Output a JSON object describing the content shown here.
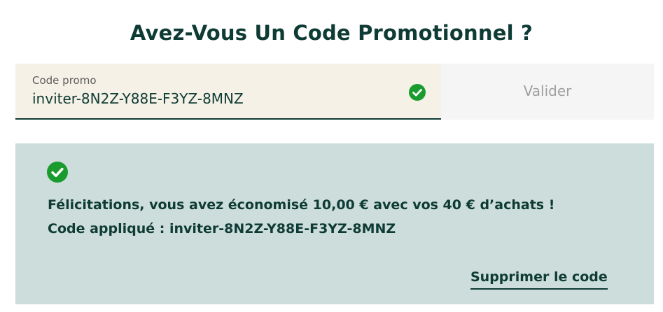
{
  "heading": "Avez-Vous Un Code Promotionnel ?",
  "promo": {
    "label": "Code promo",
    "value": "inviter-8N2Z-Y88E-F3YZ-8MNZ",
    "validate_label": "Valider",
    "status_icon": "check-circle-icon"
  },
  "success": {
    "icon": "check-circle-icon",
    "message": "Félicitations, vous avez économisé 10,00 € avec vos 40 € d’achats !",
    "applied": "Code appliqué : inviter-8N2Z-Y88E-F3YZ-8MNZ",
    "remove_label": "Supprimer le code"
  },
  "colors": {
    "primary": "#0e3b34",
    "success_green": "#1a9b2e",
    "field_bg": "#f5f1e6",
    "panel_bg": "#ccdddb",
    "button_bg": "#f5f5f5",
    "button_text": "#a0a0a0"
  }
}
